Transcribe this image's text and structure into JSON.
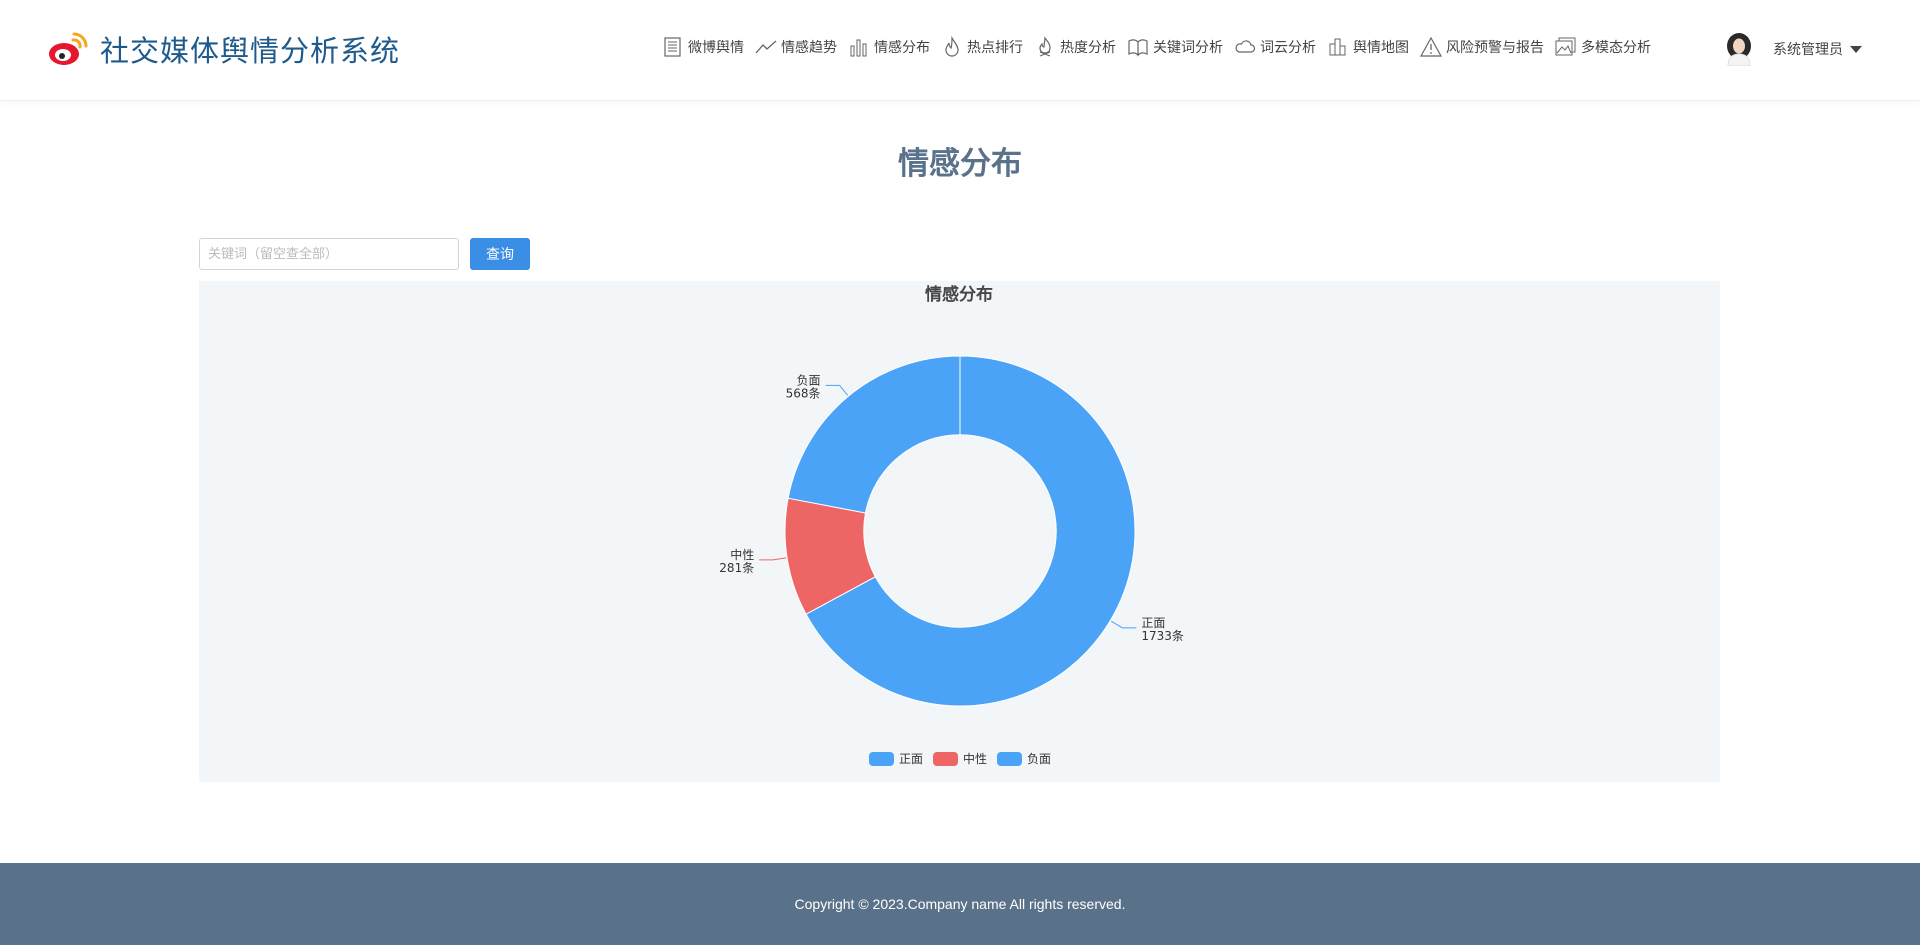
{
  "app": {
    "brand_title": "社交媒体舆情分析系统",
    "logo_icon": "weibo-logo-icon"
  },
  "nav": {
    "items": [
      {
        "label": "微博舆情",
        "icon": "document-icon"
      },
      {
        "label": "情感趋势",
        "icon": "trend-line-icon"
      },
      {
        "label": "情感分布",
        "icon": "bar-chart-icon"
      },
      {
        "label": "热点排行",
        "icon": "flame-icon"
      },
      {
        "label": "热度分析",
        "icon": "fire-icon"
      },
      {
        "label": "关键词分析",
        "icon": "book-icon"
      },
      {
        "label": "词云分析",
        "icon": "cloud-icon"
      },
      {
        "label": "舆情地图",
        "icon": "map-bars-icon"
      },
      {
        "label": "风险预警与报告",
        "icon": "warning-icon"
      },
      {
        "label": "多模态分析",
        "icon": "image-icon"
      }
    ]
  },
  "user": {
    "name": "系统管理员"
  },
  "page": {
    "title": "情感分布"
  },
  "search": {
    "placeholder": "关键词（留空查全部）",
    "value": "",
    "button_label": "查询"
  },
  "chart_data": {
    "type": "pie",
    "title": "情感分布",
    "categories": [
      "正面",
      "中性",
      "负面"
    ],
    "values": [
      1733,
      281,
      568
    ],
    "unit": "条",
    "colors": [
      "#4aa3f7",
      "#ee6566",
      "#4aa3f7"
    ],
    "inner_radius_ratio": 0.55,
    "label_position": "outside",
    "legend": "bottom-center"
  },
  "footer": {
    "copyright": "Copyright © 2023.Company name All rights reserved."
  }
}
